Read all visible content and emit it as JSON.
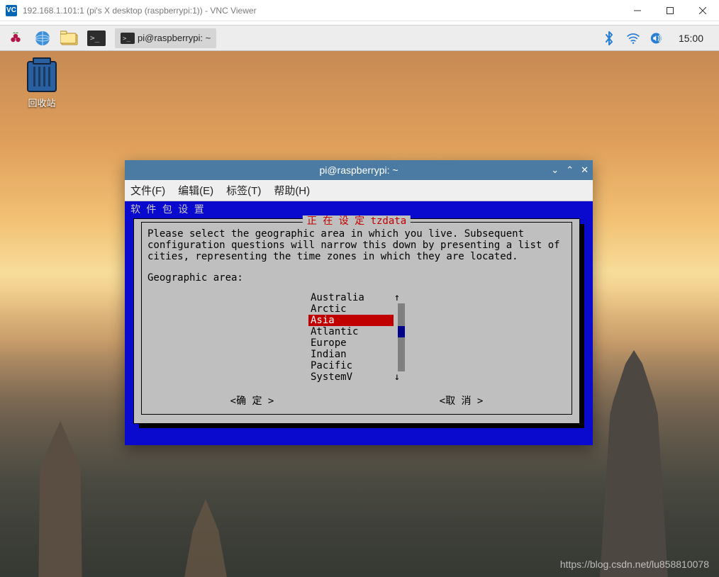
{
  "window": {
    "vnc_logo_text": "VC",
    "title": "192.168.1.101:1 (pi's X desktop (raspberrypi:1)) - VNC Viewer"
  },
  "panel": {
    "taskbar_item": "pi@raspberrypi: ~",
    "clock": "15:00"
  },
  "desktop": {
    "trash_label": "回收站"
  },
  "terminal": {
    "title": "pi@raspberrypi: ~",
    "menu": {
      "file": "文件(F)",
      "edit": "编辑(E)",
      "tabs": "标签(T)",
      "help": "帮助(H)"
    }
  },
  "ncurses": {
    "header": "软 件 包 设 置",
    "dialog_title": "正 在 设 定  tzdata",
    "body_line1": "Please select the geographic area in which you live. Subsequent",
    "body_line2": "configuration questions will narrow this down by presenting a list of",
    "body_line3": "cities, representing the time zones in which they are located.",
    "prompt": "Geographic area:",
    "items": {
      "a": "Australia",
      "b": "Arctic",
      "c": "Asia",
      "d": "Atlantic",
      "e": "Europe",
      "f": "Indian",
      "g": "Pacific",
      "h": "SystemV"
    },
    "scroll_up": "↑",
    "scroll_down": "↓",
    "ok": "<确 定 >",
    "cancel": "<取 消 >"
  },
  "watermark": "https://blog.csdn.net/lu858810078"
}
